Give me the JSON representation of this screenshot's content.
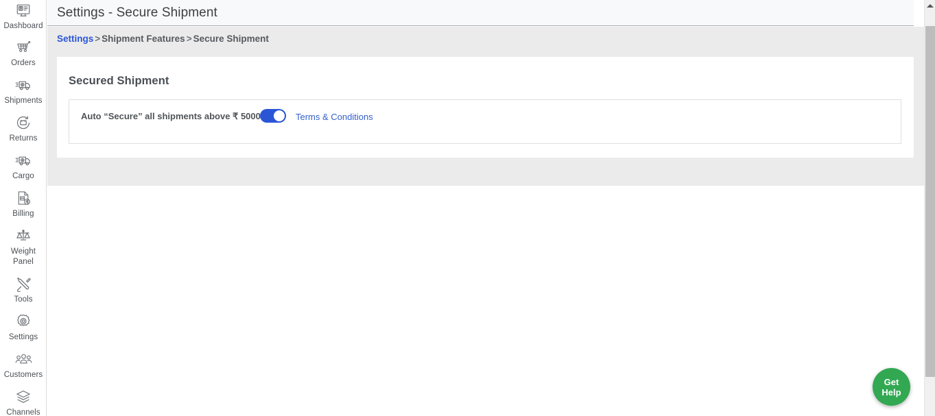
{
  "colors": {
    "accent_blue": "#2a56d6",
    "link_blue": "#3360cc",
    "help_green": "#32a852",
    "page_bg": "#ebebeb",
    "titlebar_bg": "#f8f9fb",
    "scroll_thumb": "#bdbdbd"
  },
  "sidebar": {
    "items": [
      {
        "label": "Dashboard",
        "icon": "dashboard-icon"
      },
      {
        "label": "Orders",
        "icon": "cart-icon"
      },
      {
        "label": "Shipments",
        "icon": "truck-icon"
      },
      {
        "label": "Returns",
        "icon": "return-box-icon"
      },
      {
        "label": "Cargo",
        "icon": "truck-icon"
      },
      {
        "label": "Billing",
        "icon": "invoice-rupee-icon"
      },
      {
        "label": "Weight Panel",
        "icon": "scales-icon"
      },
      {
        "label": "Tools",
        "icon": "tools-icon"
      },
      {
        "label": "Settings",
        "icon": "gear-icon"
      },
      {
        "label": "Customers",
        "icon": "people-icon"
      },
      {
        "label": "Channels",
        "icon": "layers-icon"
      }
    ]
  },
  "header": {
    "title": "Settings - Secure Shipment"
  },
  "breadcrumb": {
    "link": "Settings",
    "sep1": ">",
    "level2": "Shipment Features",
    "sep2": ">",
    "level3": "Secure Shipment"
  },
  "card": {
    "title": "Secured Shipment",
    "setting": {
      "label": "Auto “Secure” all shipments above ₹ 5000",
      "toggle_state": "on",
      "terms_link": "Terms & Conditions"
    }
  },
  "help_button": {
    "line1": "Get",
    "line2": "Help"
  }
}
